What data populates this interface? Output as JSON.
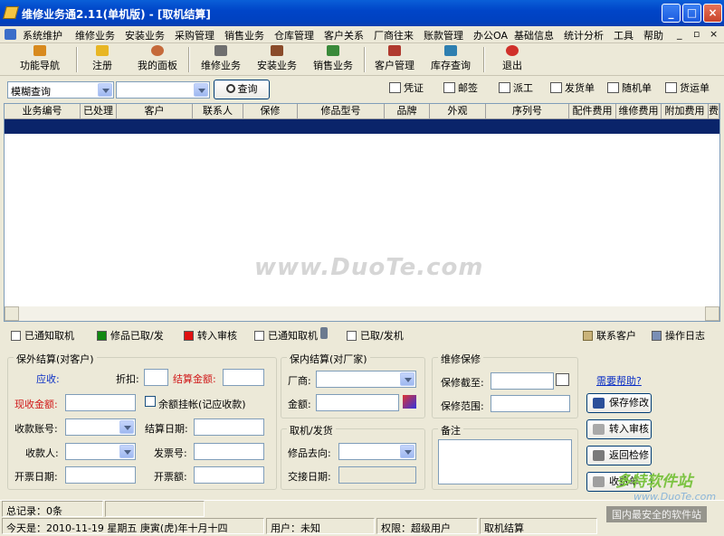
{
  "window": {
    "title": "维修业务通2.11(单机版) - [取机结算]"
  },
  "menu": [
    "系统维护",
    "维修业务",
    "安装业务",
    "采购管理",
    "销售业务",
    "仓库管理",
    "客户关系",
    "厂商往来",
    "账款管理",
    "办公OA",
    "基础信息",
    "统计分析",
    "工具",
    "帮助"
  ],
  "toolbar": [
    "功能导航",
    "注册",
    "我的面板",
    "维修业务",
    "安装业务",
    "销售业务",
    "客户管理",
    "库存查询",
    "退出"
  ],
  "search": {
    "mode": "模糊查询",
    "field": "",
    "button": "查询"
  },
  "actions": [
    "凭证",
    "邮签",
    "派工",
    "发货单",
    "随机单",
    "货运单"
  ],
  "grid": {
    "columns": [
      "业务编号",
      "已处理",
      "客户",
      "联系人",
      "保修",
      "修品型号",
      "品牌",
      "外观",
      "序列号",
      "配件费用",
      "维修费用",
      "附加费用",
      "费"
    ]
  },
  "watermark": "www.DuoTe.com",
  "legend": {
    "notified": "已通知取机",
    "picked": "修品已取/发",
    "audit": "转入审核",
    "notified2": "已通知取机",
    "picked2": "已取/发机",
    "contact": "联系客户",
    "log": "操作日志"
  },
  "colors": {
    "picked": "#118811",
    "audit": "#E01010"
  },
  "out_warranty": {
    "title": "保外结算(对客户)",
    "receivable": "应收:",
    "discount": "折扣:",
    "settle_amount": "结算金额:",
    "cash_amount": "现收金额:",
    "on_account": "余额挂帐(记应收款)",
    "account_no": "收款账号:",
    "settle_date": "结算日期:",
    "payee": "收款人:",
    "invoice_no": "发票号:",
    "invoice_date": "开票日期:",
    "invoice_amount": "开票额:"
  },
  "in_warranty": {
    "title": "保内结算(对厂家)",
    "vendor": "厂商:",
    "amount": "金额:"
  },
  "pickup": {
    "title": "取机/发货",
    "destination": "修品去向:",
    "handover_date": "交接日期:"
  },
  "maintenance": {
    "title": "维修保修",
    "expire": "保修截至:",
    "scope": "保修范围:"
  },
  "remarks": {
    "title": "备注"
  },
  "side": {
    "help": "需要帮助?",
    "save": "保存修改",
    "to_audit": "转入审核",
    "back": "返回检修",
    "charge": "收费单"
  },
  "status": {
    "total": "总记录：0条",
    "today": "今天是：2010-11-19 星期五 庚寅(虎)年十月十四",
    "user": "用户：未知",
    "role": "权限：超级用户",
    "module": "取机结算"
  },
  "brand": {
    "logo": "多特软件站",
    "url": "www.DuoTe.com",
    "slogan": "国内最安全的软件站"
  }
}
